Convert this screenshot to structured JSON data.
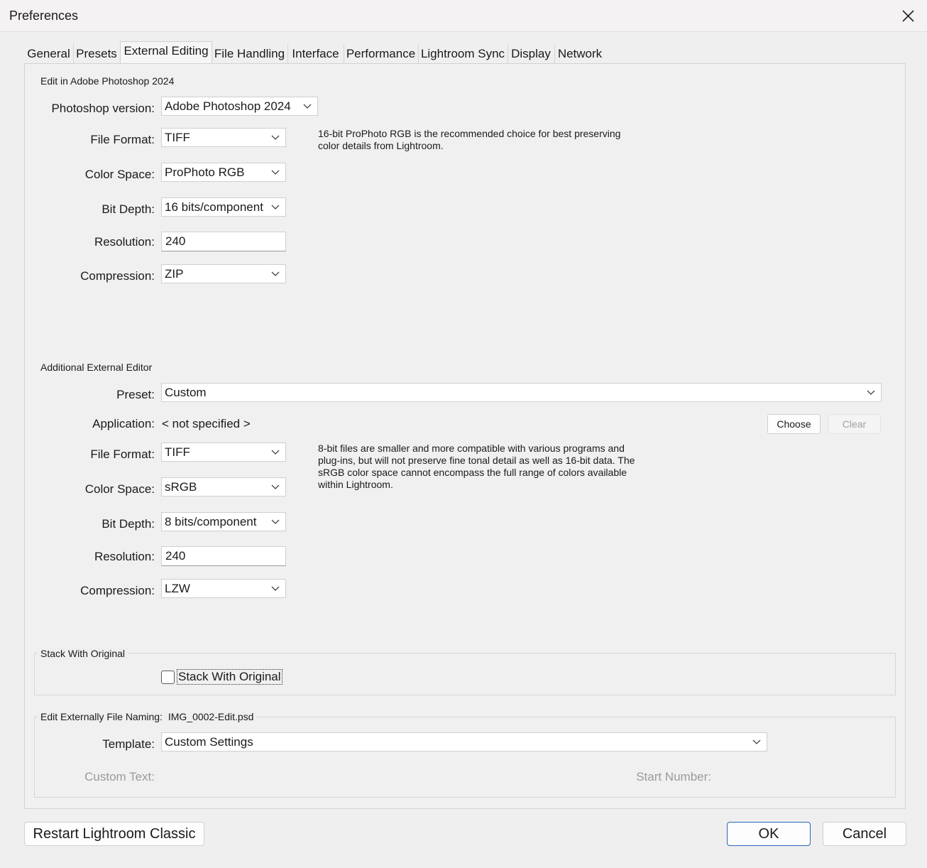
{
  "window": {
    "title": "Preferences"
  },
  "tabs": [
    {
      "label": "General"
    },
    {
      "label": "Presets"
    },
    {
      "label": "External Editing"
    },
    {
      "label": "File Handling"
    },
    {
      "label": "Interface"
    },
    {
      "label": "Performance"
    },
    {
      "label": "Lightroom Sync"
    },
    {
      "label": "Display"
    },
    {
      "label": "Network"
    }
  ],
  "photoshop": {
    "group_label": "Edit in Adobe Photoshop 2024",
    "version_label": "Photoshop version:",
    "version_value": "Adobe Photoshop 2024",
    "file_format_label": "File Format:",
    "file_format_value": "TIFF",
    "color_space_label": "Color Space:",
    "color_space_value": "ProPhoto RGB",
    "bit_depth_label": "Bit Depth:",
    "bit_depth_value": "16 bits/component",
    "resolution_label": "Resolution:",
    "resolution_value": "240",
    "compression_label": "Compression:",
    "compression_value": "ZIP",
    "note_line1": "16-bit ProPhoto RGB is the recommended choice for best preserving",
    "note_line2": "color details from Lightroom."
  },
  "additional": {
    "group_label": "Additional External Editor",
    "preset_label": "Preset:",
    "preset_value": "Custom",
    "application_label": "Application:",
    "application_value": "< not specified >",
    "choose_label": "Choose",
    "clear_label": "Clear",
    "file_format_label": "File Format:",
    "file_format_value": "TIFF",
    "color_space_label": "Color Space:",
    "color_space_value": "sRGB",
    "bit_depth_label": "Bit Depth:",
    "bit_depth_value": "8 bits/component",
    "resolution_label": "Resolution:",
    "resolution_value": "240",
    "compression_label": "Compression:",
    "compression_value": "LZW",
    "note_line1": "8-bit files are smaller and more compatible with various programs and",
    "note_line2": "plug-ins, but will not preserve fine tonal detail as well as 16-bit data. The",
    "note_line3": "sRGB color space cannot encompass the full range of colors available",
    "note_line4": "within Lightroom."
  },
  "stack": {
    "group_label": "Stack With Original",
    "checkbox_label": "Stack With Original",
    "checked": false
  },
  "naming": {
    "group_label": "Edit Externally File Naming:",
    "example": "IMG_0002-Edit.psd",
    "template_label": "Template:",
    "template_value": "Custom Settings",
    "custom_text_label": "Custom Text:",
    "start_number_label": "Start Number:"
  },
  "footer": {
    "restart_label": "Restart Lightroom Classic",
    "ok_label": "OK",
    "cancel_label": "Cancel"
  },
  "colors": {
    "primary_border": "#2a66b8",
    "background": "#efefef"
  }
}
